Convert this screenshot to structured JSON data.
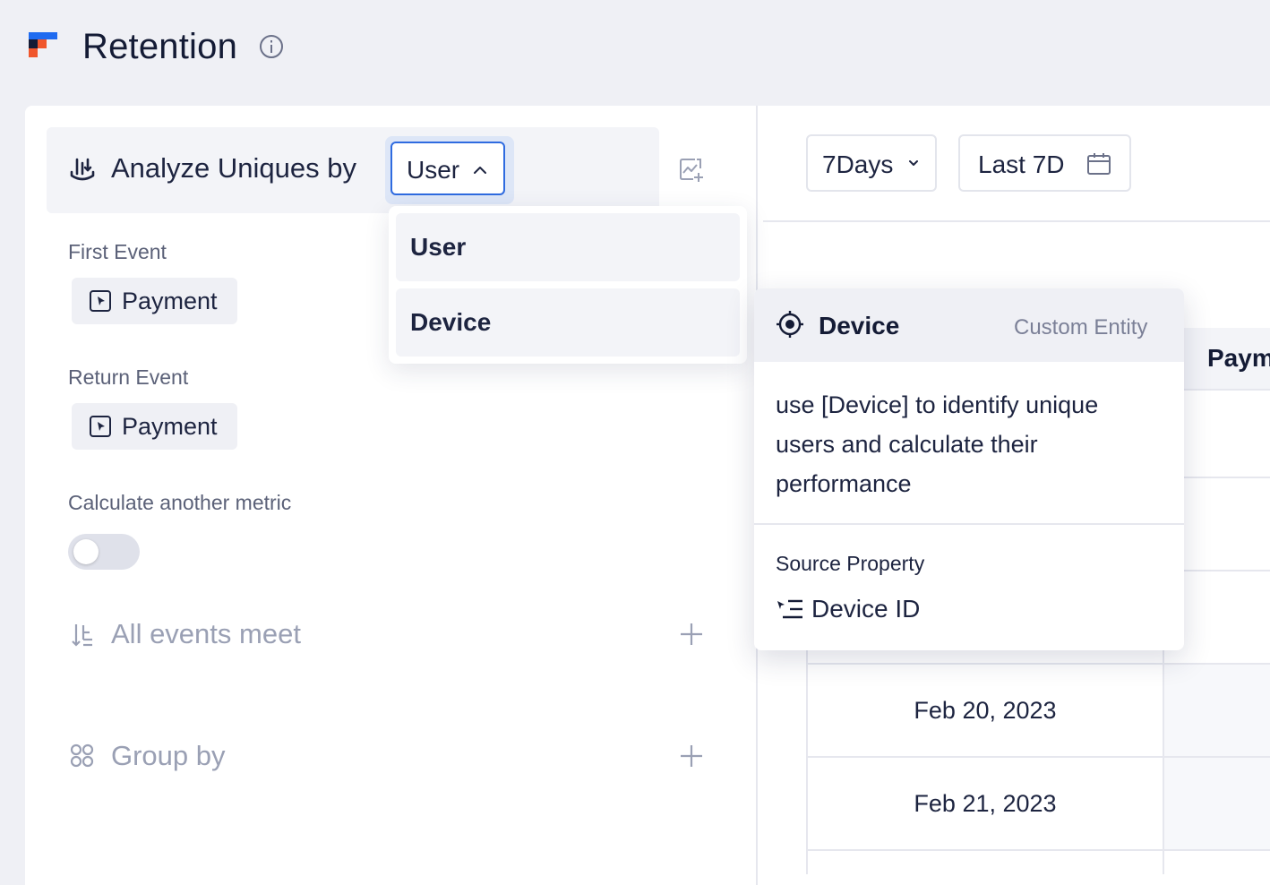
{
  "header": {
    "title": "Retention"
  },
  "analyze": {
    "label": "Analyze Uniques by",
    "selected": "User",
    "options": [
      "User",
      "Device"
    ]
  },
  "form": {
    "first_event_label": "First Event",
    "first_event_value": "Payment",
    "return_event_label": "Return Event",
    "return_event_value": "Payment",
    "another_metric_label": "Calculate another metric",
    "another_metric_enabled": false,
    "filter_label": "All events meet",
    "group_by_label": "Group by"
  },
  "controls": {
    "range": "7Days",
    "date": "Last 7D"
  },
  "table": {
    "column_header": "Paym",
    "rows": [
      "Feb 20, 2023",
      "Feb 21, 2023"
    ]
  },
  "tooltip": {
    "title": "Device",
    "type": "Custom Entity",
    "description": "use [Device] to identify unique users and calculate their performance",
    "source_label": "Source Property",
    "source_value": "Device ID"
  },
  "colors": {
    "accent": "#2f6be0",
    "logo_blue": "#1f6bf0",
    "logo_orange": "#f0562c",
    "logo_navy": "#141b35"
  }
}
